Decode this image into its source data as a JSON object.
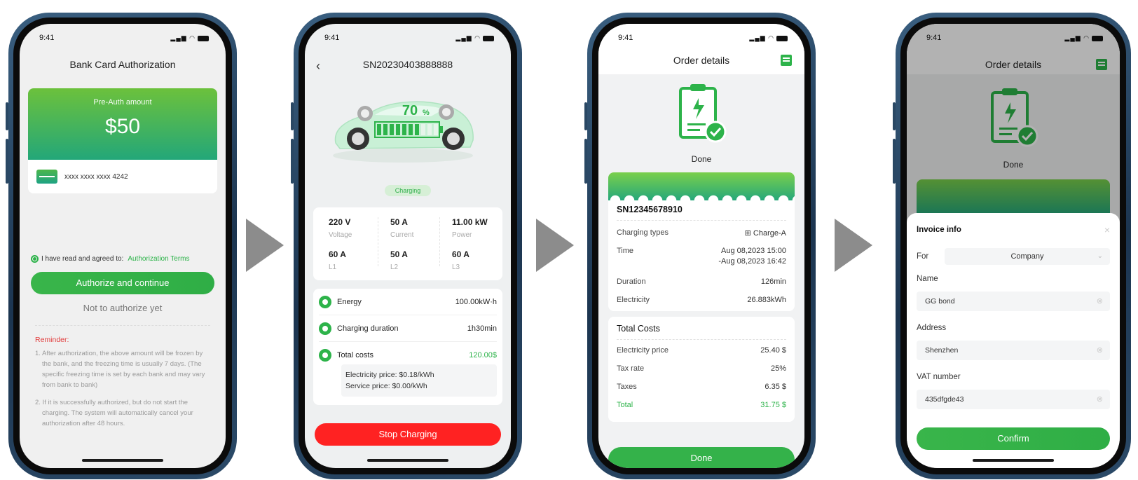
{
  "status_time": "9:41",
  "phone1": {
    "title": "Bank Card Authorization",
    "preauth_label": "Pre-Auth amount",
    "amount": "$50",
    "card_number": "xxxx xxxx xxxx 4242",
    "agree_text": "I have read and agreed to:",
    "agree_link": "Authorization Terms",
    "authorize_btn": "Authorize and continue",
    "not_authorize": "Not to authorize yet",
    "reminder_title": "Reminder:",
    "reminder_1": "1. After authorization, the above amount will be frozen by the bank, and the freezing time is usually 7 days. (The specific freezing time is set by each bank and may vary from bank to bank)",
    "reminder_2": "2. If it is successfully authorized, but do not start the charging. The system will automatically cancel your authorization after 48 hours."
  },
  "phone2": {
    "title": "SN20230403888888",
    "battery_percent": "70",
    "battery_unit": "%",
    "battery_level": 0.7,
    "status_badge": "Charging",
    "metrics": [
      {
        "value": "220 V",
        "label": "Voltage"
      },
      {
        "value": "50 A",
        "label": "Current"
      },
      {
        "value": "11.00 kW",
        "label": "Power"
      },
      {
        "value": "60 A",
        "label": "L1"
      },
      {
        "value": "50 A",
        "label": "L2"
      },
      {
        "value": "60 A",
        "label": "L3"
      }
    ],
    "energy_label": "Energy",
    "energy_value": "100.00kW·h",
    "duration_label": "Charging duration",
    "duration_value": "1h30min",
    "costs_label": "Total costs",
    "costs_value": "120.00$",
    "electricity_price": "Electricity price: $0.18/kWh",
    "service_price": "Service price: $0.00/kWh",
    "stop_btn": "Stop Charging"
  },
  "phone3": {
    "title": "Order details",
    "status": "Done",
    "sn": "SN12345678910",
    "charging_types_label": "Charging types",
    "charging_types_value": "Charge-A",
    "time_label": "Time",
    "time_start": "Aug 08,2023 15:00",
    "time_end": "-Aug 08,2023 16:42",
    "duration_label": "Duration",
    "duration_value": "126min",
    "electricity_label": "Electricity",
    "electricity_value": "26.883kWh",
    "total_costs_title": "Total Costs",
    "price_label": "Electricity price",
    "price_value": "25.40 $",
    "tax_rate_label": "Tax rate",
    "tax_rate_value": "25%",
    "taxes_label": "Taxes",
    "taxes_value": "6.35 $",
    "total_label": "Total",
    "total_value": "31.75 $",
    "done_btn": "Done"
  },
  "phone4": {
    "title": "Order details",
    "status": "Done",
    "sheet_title": "Invoice info",
    "for_label": "For",
    "for_value": "Company",
    "name_label": "Name",
    "name_value": "GG bond",
    "address_label": "Address",
    "address_value": "Shenzhen",
    "vat_label": "VAT number",
    "vat_value": "435dfgde43",
    "confirm_btn": "Confirm"
  },
  "colors": {
    "accent": "#2db34a",
    "danger": "#ff2222",
    "reminder": "#e23b3b"
  },
  "icons": [
    "back-icon",
    "receipt-icon",
    "clipboard-check-icon",
    "charge-icon",
    "close-icon",
    "clear-icon",
    "chevron-down-icon",
    "bank-card-icon"
  ]
}
